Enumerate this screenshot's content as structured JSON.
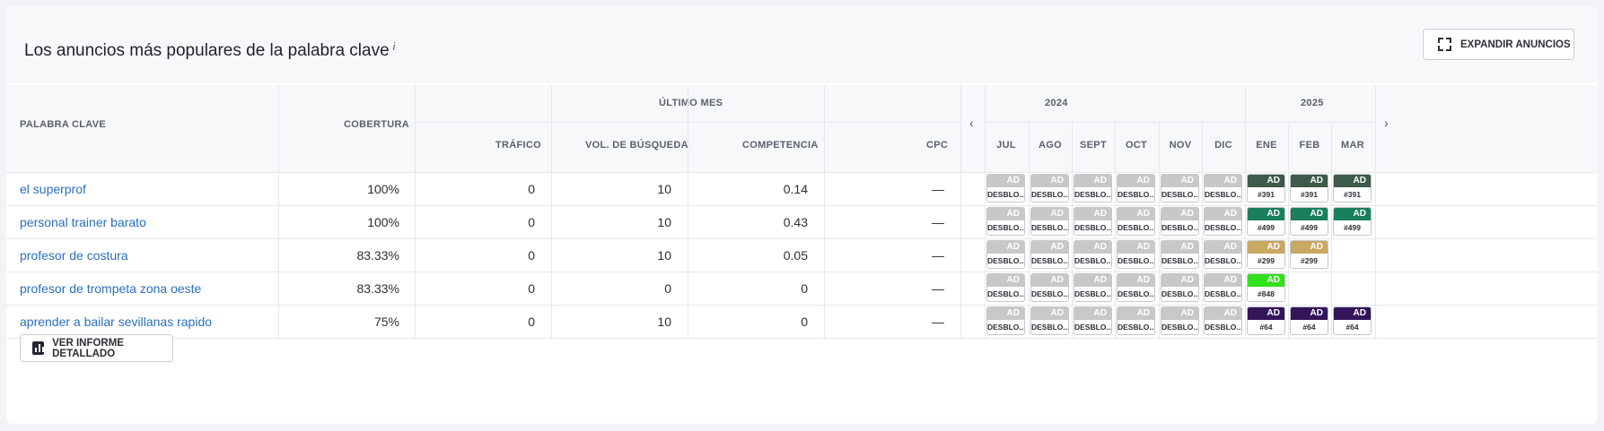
{
  "header": {
    "title": "Los anuncios más populares de la palabra clave",
    "info": "i",
    "expand_label": "EXPANDIR ANUNCIOS"
  },
  "columns": {
    "keyword": "PALABRA CLAVE",
    "coverage": "COBERTURA",
    "last_month": "ÚLTIMO MES",
    "traffic": "TRÁFICO",
    "volume": "VOL. DE BÚSQUEDA",
    "competition": "COMPETENCIA",
    "cpc": "CPC",
    "year1": "2024",
    "year2": "2025",
    "months": [
      "JUL",
      "AGO",
      "SEPT",
      "OCT",
      "NOV",
      "DIC",
      "ENE",
      "FEB",
      "MAR"
    ]
  },
  "rows": [
    {
      "keyword": "el superprof",
      "coverage": "100%",
      "traffic": "0",
      "volume": "10",
      "competition": "0.14",
      "cpc": "—",
      "ads": [
        {
          "t": "AD",
          "b": "DESBLO...",
          "c": "#c8c8c8"
        },
        {
          "t": "AD",
          "b": "DESBLO...",
          "c": "#c8c8c8"
        },
        {
          "t": "AD",
          "b": "DESBLO...",
          "c": "#c8c8c8"
        },
        {
          "t": "AD",
          "b": "DESBLO...",
          "c": "#c8c8c8"
        },
        {
          "t": "AD",
          "b": "DESBLO...",
          "c": "#c8c8c8"
        },
        {
          "t": "AD",
          "b": "DESBLO...",
          "c": "#c8c8c8"
        },
        {
          "t": "AD",
          "b": "#391",
          "c": "#3d5a4a"
        },
        {
          "t": "AD",
          "b": "#391",
          "c": "#3d5a4a"
        },
        {
          "t": "AD",
          "b": "#391",
          "c": "#3d5a4a"
        }
      ]
    },
    {
      "keyword": "personal trainer barato",
      "coverage": "100%",
      "traffic": "0",
      "volume": "10",
      "competition": "0.43",
      "cpc": "—",
      "ads": [
        {
          "t": "AD",
          "b": "DESBLO...",
          "c": "#c8c8c8"
        },
        {
          "t": "AD",
          "b": "DESBLO...",
          "c": "#c8c8c8"
        },
        {
          "t": "AD",
          "b": "DESBLO...",
          "c": "#c8c8c8"
        },
        {
          "t": "AD",
          "b": "DESBLO...",
          "c": "#c8c8c8"
        },
        {
          "t": "AD",
          "b": "DESBLO...",
          "c": "#c8c8c8"
        },
        {
          "t": "AD",
          "b": "DESBLO...",
          "c": "#c8c8c8"
        },
        {
          "t": "AD",
          "b": "#499",
          "c": "#1a7f5a"
        },
        {
          "t": "AD",
          "b": "#499",
          "c": "#1a7f5a"
        },
        {
          "t": "AD",
          "b": "#499",
          "c": "#1a7f5a"
        }
      ]
    },
    {
      "keyword": "profesor de costura",
      "coverage": "83.33%",
      "traffic": "0",
      "volume": "10",
      "competition": "0.05",
      "cpc": "—",
      "ads": [
        {
          "t": "AD",
          "b": "DESBLO...",
          "c": "#c8c8c8"
        },
        {
          "t": "AD",
          "b": "DESBLO...",
          "c": "#c8c8c8"
        },
        {
          "t": "AD",
          "b": "DESBLO...",
          "c": "#c8c8c8"
        },
        {
          "t": "AD",
          "b": "DESBLO...",
          "c": "#c8c8c8"
        },
        {
          "t": "AD",
          "b": "DESBLO...",
          "c": "#c8c8c8"
        },
        {
          "t": "AD",
          "b": "DESBLO...",
          "c": "#c8c8c8"
        },
        {
          "t": "AD",
          "b": "#299",
          "c": "#c9a862"
        },
        {
          "t": "AD",
          "b": "#299",
          "c": "#c9a862"
        }
      ]
    },
    {
      "keyword": "profesor de trompeta zona oeste",
      "coverage": "83.33%",
      "traffic": "0",
      "volume": "0",
      "competition": "0",
      "cpc": "—",
      "ads": [
        {
          "t": "AD",
          "b": "DESBLO...",
          "c": "#c8c8c8"
        },
        {
          "t": "AD",
          "b": "DESBLO...",
          "c": "#c8c8c8"
        },
        {
          "t": "AD",
          "b": "DESBLO...",
          "c": "#c8c8c8"
        },
        {
          "t": "AD",
          "b": "DESBLO...",
          "c": "#c8c8c8"
        },
        {
          "t": "AD",
          "b": "DESBLO...",
          "c": "#c8c8c8"
        },
        {
          "t": "AD",
          "b": "DESBLO...",
          "c": "#c8c8c8"
        },
        {
          "t": "AD",
          "b": "#848",
          "c": "#33e01c"
        }
      ]
    },
    {
      "keyword": "aprender a bailar sevillanas rapido",
      "coverage": "75%",
      "traffic": "0",
      "volume": "10",
      "competition": "0",
      "cpc": "—",
      "ads": [
        {
          "t": "AD",
          "b": "DESBLO...",
          "c": "#c8c8c8"
        },
        {
          "t": "AD",
          "b": "DESBLO...",
          "c": "#c8c8c8"
        },
        {
          "t": "AD",
          "b": "DESBLO...",
          "c": "#c8c8c8"
        },
        {
          "t": "AD",
          "b": "DESBLO...",
          "c": "#c8c8c8"
        },
        {
          "t": "AD",
          "b": "DESBLO...",
          "c": "#c8c8c8"
        },
        {
          "t": "AD",
          "b": "DESBLO...",
          "c": "#c8c8c8"
        },
        {
          "t": "AD",
          "b": "#64",
          "c": "#34155a"
        },
        {
          "t": "AD",
          "b": "#64",
          "c": "#34155a"
        },
        {
          "t": "AD",
          "b": "#64",
          "c": "#34155a"
        }
      ]
    }
  ],
  "footer": {
    "report_label": "VER INFORME DETALLADO"
  },
  "nav": {
    "prev": "‹",
    "next": "›"
  }
}
